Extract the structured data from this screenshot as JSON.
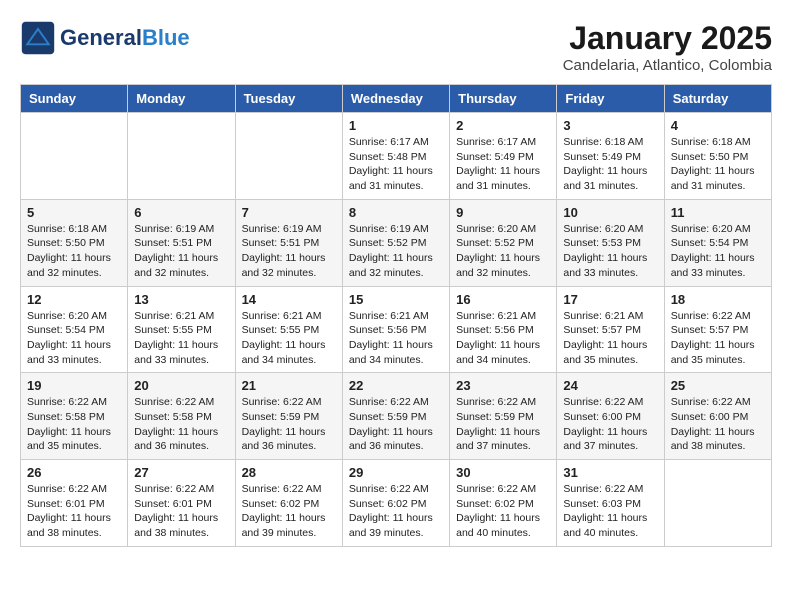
{
  "header": {
    "logo_general": "General",
    "logo_blue": "Blue",
    "month_title": "January 2025",
    "subtitle": "Candelaria, Atlantico, Colombia"
  },
  "days_of_week": [
    "Sunday",
    "Monday",
    "Tuesday",
    "Wednesday",
    "Thursday",
    "Friday",
    "Saturday"
  ],
  "weeks": [
    [
      {
        "day": "",
        "content": ""
      },
      {
        "day": "",
        "content": ""
      },
      {
        "day": "",
        "content": ""
      },
      {
        "day": "1",
        "content": "Sunrise: 6:17 AM\nSunset: 5:48 PM\nDaylight: 11 hours\nand 31 minutes."
      },
      {
        "day": "2",
        "content": "Sunrise: 6:17 AM\nSunset: 5:49 PM\nDaylight: 11 hours\nand 31 minutes."
      },
      {
        "day": "3",
        "content": "Sunrise: 6:18 AM\nSunset: 5:49 PM\nDaylight: 11 hours\nand 31 minutes."
      },
      {
        "day": "4",
        "content": "Sunrise: 6:18 AM\nSunset: 5:50 PM\nDaylight: 11 hours\nand 31 minutes."
      }
    ],
    [
      {
        "day": "5",
        "content": "Sunrise: 6:18 AM\nSunset: 5:50 PM\nDaylight: 11 hours\nand 32 minutes."
      },
      {
        "day": "6",
        "content": "Sunrise: 6:19 AM\nSunset: 5:51 PM\nDaylight: 11 hours\nand 32 minutes."
      },
      {
        "day": "7",
        "content": "Sunrise: 6:19 AM\nSunset: 5:51 PM\nDaylight: 11 hours\nand 32 minutes."
      },
      {
        "day": "8",
        "content": "Sunrise: 6:19 AM\nSunset: 5:52 PM\nDaylight: 11 hours\nand 32 minutes."
      },
      {
        "day": "9",
        "content": "Sunrise: 6:20 AM\nSunset: 5:52 PM\nDaylight: 11 hours\nand 32 minutes."
      },
      {
        "day": "10",
        "content": "Sunrise: 6:20 AM\nSunset: 5:53 PM\nDaylight: 11 hours\nand 33 minutes."
      },
      {
        "day": "11",
        "content": "Sunrise: 6:20 AM\nSunset: 5:54 PM\nDaylight: 11 hours\nand 33 minutes."
      }
    ],
    [
      {
        "day": "12",
        "content": "Sunrise: 6:20 AM\nSunset: 5:54 PM\nDaylight: 11 hours\nand 33 minutes."
      },
      {
        "day": "13",
        "content": "Sunrise: 6:21 AM\nSunset: 5:55 PM\nDaylight: 11 hours\nand 33 minutes."
      },
      {
        "day": "14",
        "content": "Sunrise: 6:21 AM\nSunset: 5:55 PM\nDaylight: 11 hours\nand 34 minutes."
      },
      {
        "day": "15",
        "content": "Sunrise: 6:21 AM\nSunset: 5:56 PM\nDaylight: 11 hours\nand 34 minutes."
      },
      {
        "day": "16",
        "content": "Sunrise: 6:21 AM\nSunset: 5:56 PM\nDaylight: 11 hours\nand 34 minutes."
      },
      {
        "day": "17",
        "content": "Sunrise: 6:21 AM\nSunset: 5:57 PM\nDaylight: 11 hours\nand 35 minutes."
      },
      {
        "day": "18",
        "content": "Sunrise: 6:22 AM\nSunset: 5:57 PM\nDaylight: 11 hours\nand 35 minutes."
      }
    ],
    [
      {
        "day": "19",
        "content": "Sunrise: 6:22 AM\nSunset: 5:58 PM\nDaylight: 11 hours\nand 35 minutes."
      },
      {
        "day": "20",
        "content": "Sunrise: 6:22 AM\nSunset: 5:58 PM\nDaylight: 11 hours\nand 36 minutes."
      },
      {
        "day": "21",
        "content": "Sunrise: 6:22 AM\nSunset: 5:59 PM\nDaylight: 11 hours\nand 36 minutes."
      },
      {
        "day": "22",
        "content": "Sunrise: 6:22 AM\nSunset: 5:59 PM\nDaylight: 11 hours\nand 36 minutes."
      },
      {
        "day": "23",
        "content": "Sunrise: 6:22 AM\nSunset: 5:59 PM\nDaylight: 11 hours\nand 37 minutes."
      },
      {
        "day": "24",
        "content": "Sunrise: 6:22 AM\nSunset: 6:00 PM\nDaylight: 11 hours\nand 37 minutes."
      },
      {
        "day": "25",
        "content": "Sunrise: 6:22 AM\nSunset: 6:00 PM\nDaylight: 11 hours\nand 38 minutes."
      }
    ],
    [
      {
        "day": "26",
        "content": "Sunrise: 6:22 AM\nSunset: 6:01 PM\nDaylight: 11 hours\nand 38 minutes."
      },
      {
        "day": "27",
        "content": "Sunrise: 6:22 AM\nSunset: 6:01 PM\nDaylight: 11 hours\nand 38 minutes."
      },
      {
        "day": "28",
        "content": "Sunrise: 6:22 AM\nSunset: 6:02 PM\nDaylight: 11 hours\nand 39 minutes."
      },
      {
        "day": "29",
        "content": "Sunrise: 6:22 AM\nSunset: 6:02 PM\nDaylight: 11 hours\nand 39 minutes."
      },
      {
        "day": "30",
        "content": "Sunrise: 6:22 AM\nSunset: 6:02 PM\nDaylight: 11 hours\nand 40 minutes."
      },
      {
        "day": "31",
        "content": "Sunrise: 6:22 AM\nSunset: 6:03 PM\nDaylight: 11 hours\nand 40 minutes."
      },
      {
        "day": "",
        "content": ""
      }
    ]
  ]
}
